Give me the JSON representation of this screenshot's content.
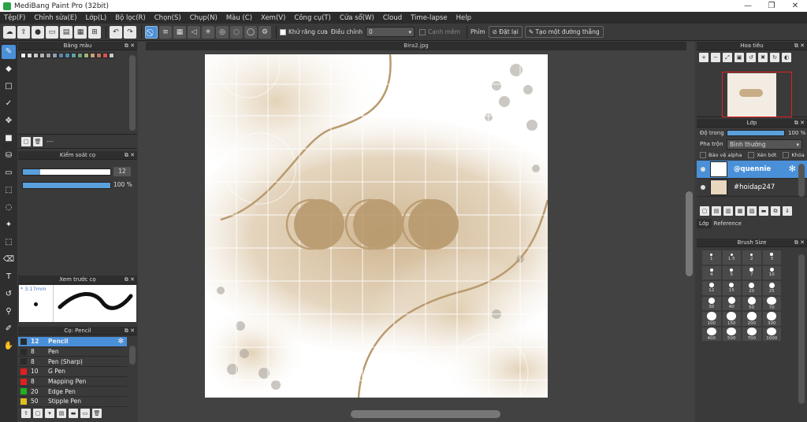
{
  "window": {
    "title": "MediBang Paint Pro (32bit)",
    "min": "—",
    "max": "❐",
    "close": "✕"
  },
  "menu": [
    "Tệp(F)",
    "Chỉnh sửa(E)",
    "Lớp(L)",
    "Bộ lọc(R)",
    "Chọn(S)",
    "Chụp(N)",
    "Màu (C)",
    "Xem(V)",
    "Công cụ(T)",
    "Cửa sổ(W)",
    "Cloud",
    "Time-lapse",
    "Help"
  ],
  "toolbar": {
    "antialias_label": "Khử răng cưa",
    "adjust_label": "Điều chỉnh",
    "adjust_value": "0",
    "smooth_label": "Cạnh mềm",
    "key_label": "Phím",
    "reset_label": "Đặt lại",
    "create_line_label": "Tạo một đường thẳng"
  },
  "palette": {
    "title": "Bảng màu",
    "footer_text": "---",
    "colors": [
      "#ffffff",
      "#dcdcdc",
      "#c8c8c8",
      "#b4b4b4",
      "#a0a0a0",
      "#8ca0b4",
      "#6482a0",
      "#508cb4",
      "#64a0a0",
      "#78a078",
      "#a0b478",
      "#c8a078",
      "#b47864",
      "#dc5050",
      "#c8c8c8"
    ]
  },
  "control": {
    "title": "Kiểm soát cọ",
    "size_value": "12",
    "opacity_value": "100 %",
    "opacity_fraction": 1.0
  },
  "preview": {
    "title": "Xem trước cọ",
    "size_text": "* 3.17mm"
  },
  "brushes": {
    "title": "Cọ: Pencil",
    "items": [
      {
        "size": "12",
        "name": "Pencil",
        "color": "#2a2a2a",
        "selected": true
      },
      {
        "size": "8",
        "name": "Pen",
        "color": "#2a2a2a"
      },
      {
        "size": "8",
        "name": "Pen (Sharp)",
        "color": "#2a2a2a"
      },
      {
        "size": "10",
        "name": "G Pen",
        "color": "#e02020"
      },
      {
        "size": "8",
        "name": "Mapping Pen",
        "color": "#e02020"
      },
      {
        "size": "20",
        "name": "Edge Pen",
        "color": "#20b020"
      },
      {
        "size": "50",
        "name": "Stipple Pen",
        "color": "#e0c020"
      }
    ]
  },
  "document": {
    "tab_title": "Bira2.jpg"
  },
  "navigator": {
    "title": "Hoa tiêu"
  },
  "layers": {
    "title": "Lớp",
    "opacity_label": "Độ trong",
    "opacity_value": "100 %",
    "blend_label": "Pha trộn",
    "blend_value": "Bình thường",
    "protect_alpha": "Bảo vệ alpha",
    "clipping": "Xén bớt",
    "lock": "Khóa",
    "items": [
      {
        "name": "@quennie",
        "selected": true
      },
      {
        "name": "#hoidap247",
        "selected": false
      }
    ],
    "tab_layer": "Lớp",
    "tab_reference": "Reference"
  },
  "brush_size": {
    "title": "Brush Size",
    "sizes": [
      "1",
      "1.5",
      "2",
      "3",
      "4",
      "5",
      "7",
      "10",
      "12",
      "15",
      "20",
      "25",
      "30",
      "40",
      "50",
      "70",
      "100",
      "150",
      "200",
      "300",
      "400",
      "500",
      "700",
      "1000"
    ]
  }
}
